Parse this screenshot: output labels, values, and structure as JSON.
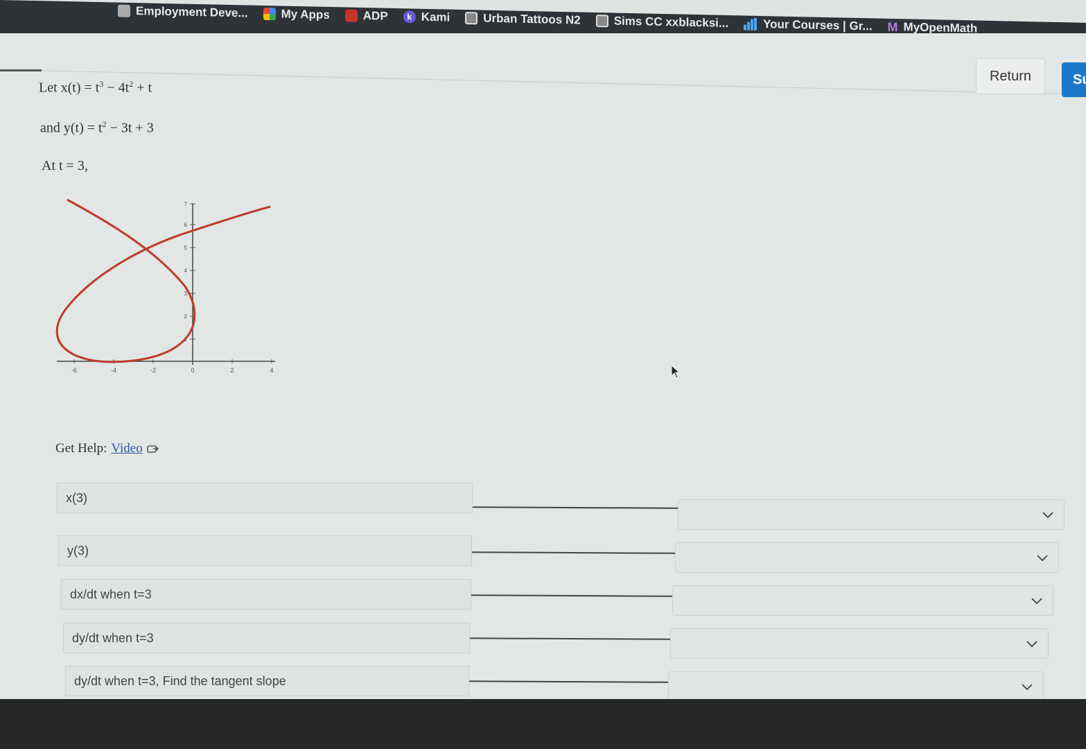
{
  "bookmarks": [
    {
      "label": "Employment Deve...",
      "icon": "folder-icon"
    },
    {
      "label": "My Apps",
      "icon": "apps-icon"
    },
    {
      "label": "ADP",
      "icon": "adp-icon"
    },
    {
      "label": "Kami",
      "icon": "kami-icon"
    },
    {
      "label": "Urban Tattoos N2",
      "icon": "photo-icon"
    },
    {
      "label": "Sims CC xxblacksi...",
      "icon": "photo-icon"
    },
    {
      "label": "Your Courses | Gr...",
      "icon": "bars-icon"
    },
    {
      "label": "MyOpenMath",
      "icon": "myopenmath-icon"
    }
  ],
  "header": {
    "return_label": "Return",
    "submit_label": "Su"
  },
  "problem": {
    "line1_prefix": "Let x(t) = t",
    "line1_exp1": "3",
    "line1_mid": " − 4t",
    "line1_exp2": "2",
    "line1_suffix": " + t",
    "line2_prefix": "and y(t) = t",
    "line2_exp": "2",
    "line2_suffix": " − 3t + 3",
    "line3": "At t = 3,"
  },
  "graph": {
    "x_ticks": [
      "-6",
      "-4",
      "-2",
      "0",
      "2",
      "4"
    ],
    "y_ticks": [
      "1",
      "2",
      "3",
      "4",
      "5",
      "6",
      "7"
    ],
    "curve_color": "#c0392b"
  },
  "help": {
    "prefix": "Get Help:",
    "link": "Video"
  },
  "rows": [
    {
      "label": "x(3)"
    },
    {
      "label": "y(3)"
    },
    {
      "label": "dx/dt when t=3"
    },
    {
      "label": "dy/dt when t=3"
    },
    {
      "label": "dy/dt when t=3, Find the tangent slope"
    }
  ]
}
